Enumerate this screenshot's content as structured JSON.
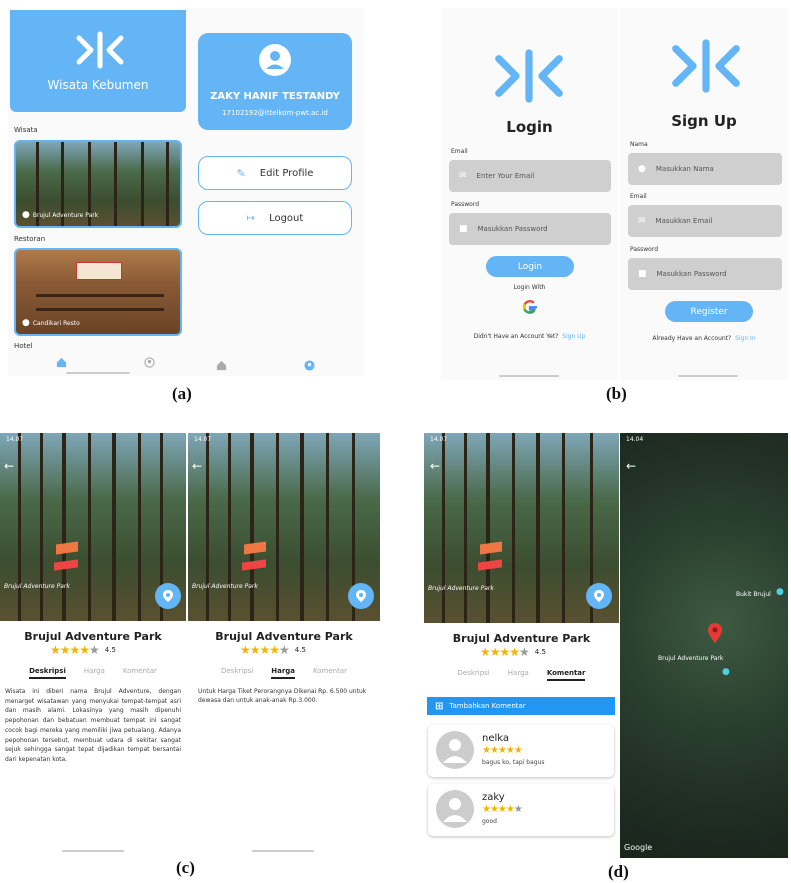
{
  "captions": {
    "a": "(a)",
    "b": "(b)",
    "c": "(c)",
    "d": "(d)"
  },
  "app": {
    "name": "Wisata Kebumen"
  },
  "home": {
    "section_wisata": "Wisata",
    "section_restoran": "Restoran",
    "section_hotel": "Hotel",
    "wisata_card_label": "Brujul Adventure Park",
    "restoran_card_label": "Candikari Resto"
  },
  "profile": {
    "name": "ZAKY HANIF TESTANDY",
    "email": "17102192@ittelkom-pwt.ac.id",
    "edit_label": "Edit Profile",
    "logout_label": "Logout"
  },
  "login": {
    "title": "Login",
    "email_label": "Email",
    "email_placeholder": "Enter Your Email",
    "password_label": "Password",
    "password_placeholder": "Masukkan Password",
    "button": "Login",
    "login_with": "Login With",
    "no_account": "Didn't Have an Account Yet?",
    "signup_link": "Sign Up"
  },
  "signup": {
    "title": "Sign Up",
    "nama_label": "Nama",
    "nama_placeholder": "Masukkan Nama",
    "email_label": "Email",
    "email_placeholder": "Masukkan Email",
    "password_label": "Password",
    "password_placeholder": "Masukkan Password",
    "button": "Register",
    "have_account": "Already Have an Account?",
    "signin_link": "Sign In"
  },
  "detail": {
    "title": "Brujul Adventure Park",
    "rating": "4.5",
    "rating_value": 4.5,
    "tab_deskripsi": "Deskripsi",
    "tab_harga": "Harga",
    "tab_komentar": "Komentar",
    "description": "Wisata ini diberi nama Brujul Adventure, dengan menarget wisatawan yang menyukai tempat-tempat asri dan masih alami. Lokasinya yang masih dipenuhi pepohonan dan bebatuan membuat tempat ini sangat cocok bagi mereka yang memiliki jiwa petualang. Adanya pepohonan tersebut, membuat udara di sekitar sangat sejuk sehingga sangat tepat dijadikan tempat bersantai dari kepenatan kota.",
    "harga_text": "Untuk Harga Tiket Perorangnya Dikenai Rp. 6.500 untuk dewasa dan untuk anak-anak Rp.3.000.",
    "poster_text": "Brujul Adventure Park"
  },
  "status": {
    "time1": "14.07",
    "time2": "14.04"
  },
  "comments": {
    "add_button": "Tambahkan Komentar",
    "items": [
      {
        "name": "nelka",
        "text": "bagus ko, tapi bagus",
        "stars": 5
      },
      {
        "name": "zaky",
        "text": "good",
        "stars": 4.5
      }
    ]
  },
  "map": {
    "label_brujul": "Brujul Adventure Park",
    "label_bukit": "Bukit Brujul",
    "attribution": "Google"
  },
  "colors": {
    "accent": "#64b5f6",
    "star": "#f4b400",
    "field": "#cfcfcf"
  }
}
